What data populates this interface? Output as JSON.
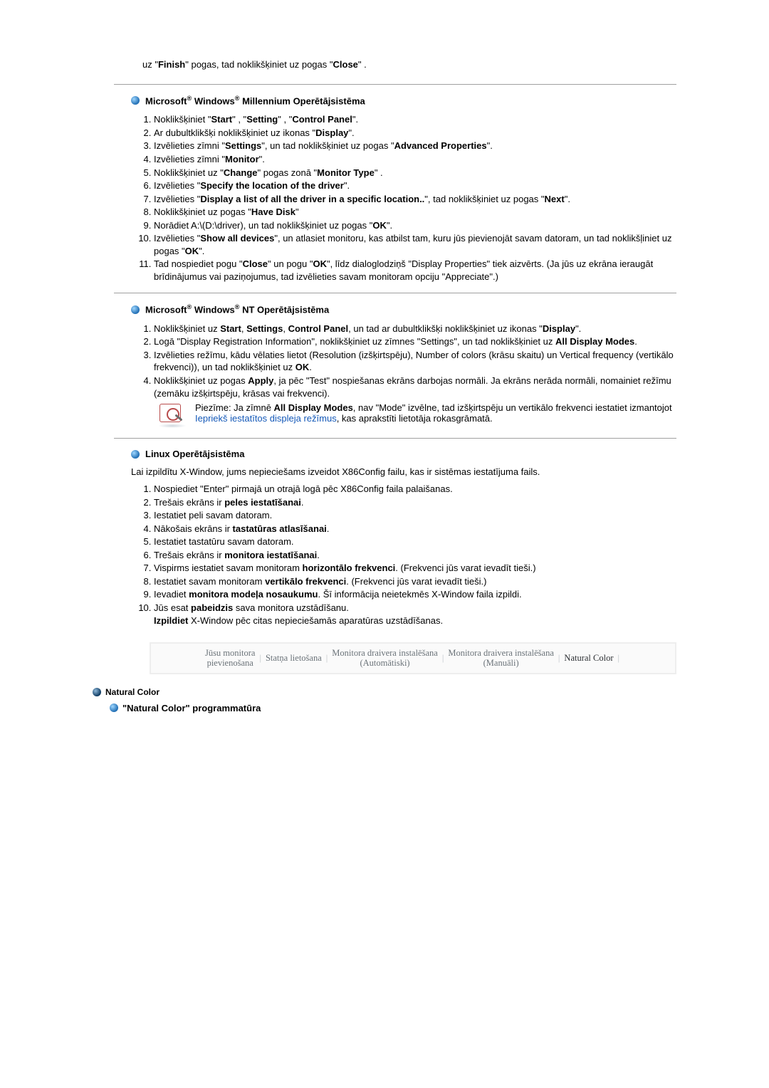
{
  "intro": {
    "pre": "uz \"",
    "b1": "Finish",
    "mid": "\" pogas, tad noklikšķiniet uz pogas \"",
    "b2": "Close",
    "post": "\" ."
  },
  "millennium": {
    "title_pre": "Microsoft",
    "title_mid": " Windows",
    "title_post": " Millennium Operētājsistēma",
    "items": [
      {
        "t1": "Noklikšķiniet \"",
        "b1": "Start",
        "t2": "\" , \"",
        "b2": "Setting",
        "t3": "\" , \"",
        "b3": "Control Panel",
        "t4": "\"."
      },
      {
        "t1": "Ar dubultklikšķi noklikšķiniet uz ikonas \"",
        "b1": "Display",
        "t2": "\"."
      },
      {
        "t1": "Izvēlieties zīmni \"",
        "b1": "Settings",
        "t2": "\", un tad noklikšķiniet uz pogas \"",
        "b2": "Advanced Properties",
        "t3": "\"."
      },
      {
        "t1": "Izvēlieties zīmni \"",
        "b1": "Monitor",
        "t2": "\"."
      },
      {
        "t1": "Noklikšķiniet uz \"",
        "b1": "Change",
        "t2": "\" pogas zonā \"",
        "b2": "Monitor Type",
        "t3": "\" ."
      },
      {
        "t1": "Izvēlieties \"",
        "b1": "Specify the location of the driver",
        "t2": "\"."
      },
      {
        "t1": "Izvēlieties \"",
        "b1": "Display a list of all the driver in a specific location..",
        "t2": "\", tad noklikšķiniet uz pogas \"",
        "b2": "Next",
        "t3": "\"."
      },
      {
        "t1": "Noklikšķiniet uz pogas \"",
        "b1": "Have Disk",
        "t2": "\""
      },
      {
        "t1": "Norādiet A:\\(D:\\driver), un tad noklikšķiniet uz pogas \"",
        "b1": "OK",
        "t2": "\"."
      },
      {
        "t1": "Izvēlieties \"",
        "b1": "Show all devices",
        "t2": "\", un atlasiet monitoru, kas atbilst tam, kuru jūs pievienojāt savam datoram, un tad noklikšļiniet uz pogas \"",
        "b2": "OK",
        "t3": "\"."
      },
      {
        "t1": "Tad nospiediet pogu \"",
        "b1": "Close",
        "t2": "\" un pogu \"",
        "b2": "OK",
        "t3": "\", līdz dialoglodziņš \"Display Properties\" tiek aizvērts. (Ja jūs uz ekrāna ieraugāt brīdinājumus vai paziņojumus, tad izvēlieties savam monitoram opciju \"Appreciate\".)"
      }
    ]
  },
  "nt": {
    "title_pre": "Microsoft",
    "title_mid": " Windows",
    "title_post": " NT Operētājsistēma",
    "items": [
      {
        "t1": "Noklikšķiniet uz ",
        "b1": "Start",
        "t2": ", ",
        "b2": "Settings",
        "t3": ", ",
        "b3": "Control Panel",
        "t4": ", un tad ar dubultklikšķi noklikšķiniet uz ikonas \"",
        "b4": "Display",
        "t5": "\"."
      },
      {
        "t1": "Logā \"Display Registration Information\", noklikšķiniet uz zīmnes \"Settings\", un tad noklikšķiniet uz ",
        "b1": "All Display Modes",
        "t2": "."
      },
      {
        "t1": "Izvēlieties režīmu, kādu vēlaties lietot (Resolution (izšķirtspēju), Number of colors (krāsu skaitu) un Vertical frequency (vertikālo frekvenci)), un tad noklikšķiniet uz ",
        "b1": "OK",
        "t2": "."
      },
      {
        "t1": "Noklikšķiniet uz pogas ",
        "b1": "Apply",
        "t2": ", ja pēc \"Test\" nospiešanas ekrāns darbojas normāli. Ja ekrāns nerāda normāli, nomainiet režīmu (zemāku izšķirtspēju, krāsas vai frekvenci)."
      }
    ],
    "note_t1": "Piezīme: Ja zīmnē ",
    "note_b1": "All Display Modes",
    "note_t2": ", nav \"Mode\" izvēlne, tad izšķirtspēju un vertikālo frekvenci iestatiet izmantojot ",
    "note_link": "Iepriekš iestatītos displeja režīmus",
    "note_t3": ", kas aprakstīti lietotāja rokasgrāmatā."
  },
  "linux": {
    "title": "Linux Operētājsistēma",
    "intro": "Lai izpildītu X-Window, jums nepieciešams izveidot X86Config failu, kas ir sistēmas iestatījuma fails.",
    "items": [
      {
        "t1": "Nospiediet \"Enter\" pirmajā un otrajā logā pēc X86Config faila palaišanas."
      },
      {
        "t1": "Trešais ekrāns ir ",
        "b1": "peles iestatīšanai",
        "t2": "."
      },
      {
        "t1": "Iestatiet peli savam datoram."
      },
      {
        "t1": "Nākošais ekrāns ir ",
        "b1": "tastatūras atlasīšanai",
        "t2": "."
      },
      {
        "t1": "Iestatiet tastatūru savam datoram."
      },
      {
        "t1": "Trešais ekrāns ir ",
        "b1": "monitora iestatīšanai",
        "t2": "."
      },
      {
        "t1": "Vispirms iestatiet savam monitoram ",
        "b1": "horizontālo frekvenci",
        "t2": ". (Frekvenci jūs varat ievadīt tieši.)"
      },
      {
        "t1": "Iestatiet savam monitoram ",
        "b1": "vertikālo frekvenci",
        "t2": ". (Frekvenci jūs varat ievadīt tieši.)"
      },
      {
        "t1": "Ievadiet ",
        "b1": "monitora modeļa nosaukumu",
        "t2": ". Šī informācija neietekmēs X-Window faila izpildi."
      },
      {
        "t1": "Jūs esat ",
        "b1": "pabeidzis",
        "t2": " sava monitora uzstādīšanu.",
        "br": true,
        "b2": "Izpildiet",
        "t3": " X-Window pēc citas nepieciešamās aparatūras uzstādīšanas."
      }
    ]
  },
  "nav": {
    "i1": "Jūsu monitora\npievienošana",
    "i2": "Statņa lietošana",
    "i3": "Monitora draivera instalēšana\n(Automātiski)",
    "i4": "Monitora draivera instalēšana\n(Manuāli)",
    "i5": "Natural Color"
  },
  "natural": {
    "small": "Natural Color",
    "title": "\"Natural Color\" programmatūra"
  }
}
